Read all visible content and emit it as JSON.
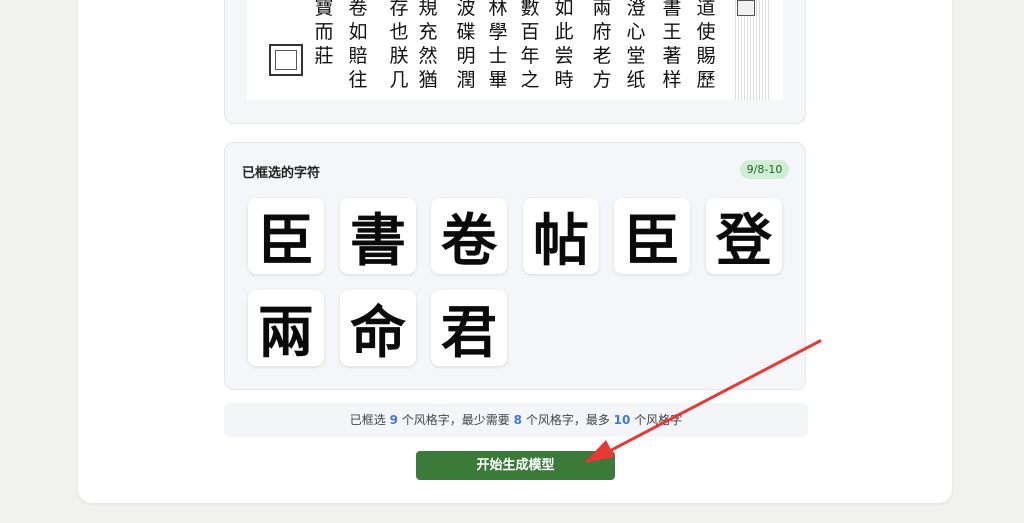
{
  "preview": {
    "columns": [
      {
        "text": "寶而莊"
      },
      {
        "text": "卷如賠往"
      },
      {
        "text": "存也朕几"
      },
      {
        "text": "規充然猶"
      },
      {
        "text": "波碟明潤"
      },
      {
        "text": "林學士畢"
      },
      {
        "text": "數百年之"
      },
      {
        "text": "如此尝時"
      },
      {
        "text": "兩府老方"
      },
      {
        "text": "澄心堂纸"
      },
      {
        "text": "書王著样"
      },
      {
        "text": "道使賜歷"
      }
    ]
  },
  "selection": {
    "title": "已框选的字符",
    "badge": "9/8-10",
    "chars": [
      "臣",
      "書",
      "卷",
      "帖",
      "臣",
      "登",
      "兩",
      "命",
      "君"
    ]
  },
  "info": {
    "p1": "已框选",
    "selected": "9",
    "p2": "个风格字，最少需要",
    "min": "8",
    "p3": "个风格字，最多",
    "max": "10",
    "p4": "个风格字"
  },
  "button": {
    "label": "开始生成模型"
  },
  "colors": {
    "accent": "#3b7b3a",
    "number": "#3d79d6",
    "arrow": "#e53935"
  }
}
